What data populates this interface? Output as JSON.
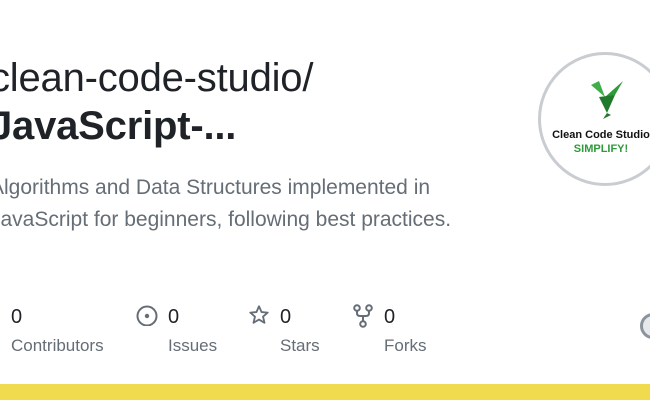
{
  "repo": {
    "owner": "clean-code-studio/",
    "name": "JavaScript-...",
    "description": "Algorithms and Data Structures implemented in JavaScript for beginners, following best practices."
  },
  "logo": {
    "name": "Clean Code Studio",
    "tagline": "SIMPLIFY!",
    "accent_color": "#2f9a3a"
  },
  "stats": [
    {
      "count": "0",
      "label": "Contributors",
      "icon": "people-icon"
    },
    {
      "count": "0",
      "label": "Issues",
      "icon": "issue-icon"
    },
    {
      "count": "0",
      "label": "Stars",
      "icon": "star-icon"
    },
    {
      "count": "0",
      "label": "Forks",
      "icon": "fork-icon"
    }
  ],
  "colors": {
    "language_bar": "#f0db4f",
    "muted_text": "#656d76",
    "primary_text": "#1f2328"
  }
}
